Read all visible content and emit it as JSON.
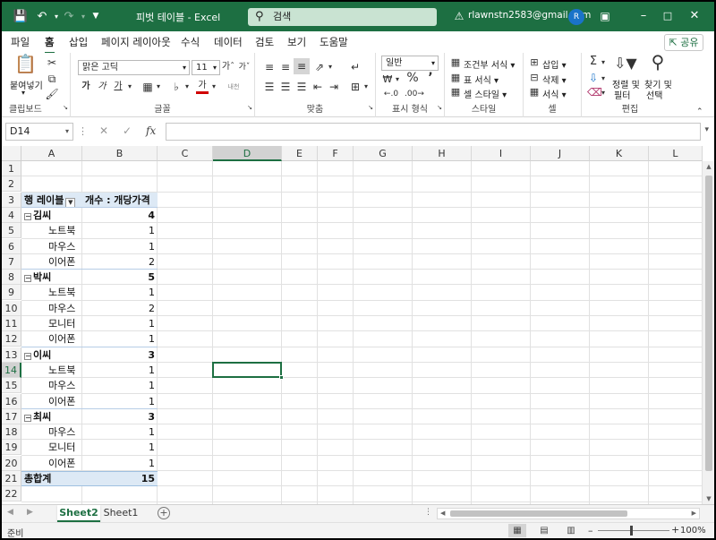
{
  "titlebar": {
    "document": "피벗 테이블  -  Excel",
    "search_placeholder": "검색",
    "user_email": "rlawnstn2583@gmail.com",
    "avatar_initial": "R"
  },
  "menu": {
    "tabs": [
      "파일",
      "홈",
      "삽입",
      "페이지 레이아웃",
      "수식",
      "데이터",
      "검토",
      "보기",
      "도움말"
    ],
    "active": "홈",
    "share_label": "공유"
  },
  "ribbon": {
    "clipboard": {
      "paste": "붙여넣기",
      "label": "클립보드"
    },
    "font": {
      "name": "맑은 고딕",
      "size": "11",
      "label": "글꼴",
      "bold": "가",
      "italic": "가",
      "underline": "가",
      "font_color_glyph": "가",
      "phonetic": "내천"
    },
    "align": {
      "label": "맞춤"
    },
    "number": {
      "format": "일반",
      "label": "표시 형식"
    },
    "styles": {
      "conditional": "조건부 서식",
      "table": "표 서식",
      "cell": "셀 스타일",
      "label": "스타일"
    },
    "cells": {
      "insert": "삽입",
      "delete": "삭제",
      "format": "서식",
      "label": "셀"
    },
    "editing": {
      "sort_line1": "정렬 및",
      "sort_line2": "필터",
      "find_line1": "찾기 및",
      "find_line2": "선택",
      "label": "편집"
    }
  },
  "formula_bar": {
    "name_box": "D14",
    "fx": "fx",
    "formula": ""
  },
  "grid": {
    "columns": [
      "A",
      "B",
      "C",
      "D",
      "E",
      "F",
      "G",
      "H",
      "I",
      "J",
      "K",
      "L"
    ],
    "rows": [
      "1",
      "2",
      "3",
      "4",
      "5",
      "6",
      "7",
      "8",
      "9",
      "10",
      "11",
      "12",
      "13",
      "14",
      "15",
      "16",
      "17",
      "18",
      "19",
      "20",
      "21",
      "22"
    ],
    "selected_cell": "D14",
    "pivot": {
      "header_row_label": "행 레이블",
      "header_value": "개수 : 개당가격",
      "rows": [
        {
          "label": "김씨",
          "value": "4",
          "group": true
        },
        {
          "label": "노트북",
          "value": "1",
          "group": false
        },
        {
          "label": "마우스",
          "value": "1",
          "group": false
        },
        {
          "label": "이어폰",
          "value": "2",
          "group": false
        },
        {
          "label": "박씨",
          "value": "5",
          "group": true
        },
        {
          "label": "노트북",
          "value": "1",
          "group": false
        },
        {
          "label": "마우스",
          "value": "2",
          "group": false
        },
        {
          "label": "모니터",
          "value": "1",
          "group": false
        },
        {
          "label": "이어폰",
          "value": "1",
          "group": false
        },
        {
          "label": "이씨",
          "value": "3",
          "group": true
        },
        {
          "label": "노트북",
          "value": "1",
          "group": false
        },
        {
          "label": "마우스",
          "value": "1",
          "group": false
        },
        {
          "label": "이어폰",
          "value": "1",
          "group": false
        },
        {
          "label": "최씨",
          "value": "3",
          "group": true
        },
        {
          "label": "마우스",
          "value": "1",
          "group": false
        },
        {
          "label": "모니터",
          "value": "1",
          "group": false
        },
        {
          "label": "이어폰",
          "value": "1",
          "group": false
        }
      ],
      "grand_total_label": "총합계",
      "grand_total_value": "15"
    }
  },
  "sheets": {
    "tabs": [
      "Sheet2",
      "Sheet1"
    ],
    "active": "Sheet2"
  },
  "status": {
    "text": "준비",
    "zoom": "100%"
  },
  "colors": {
    "excel_green": "#1d6f42",
    "pivot_header": "#dde9f5"
  }
}
